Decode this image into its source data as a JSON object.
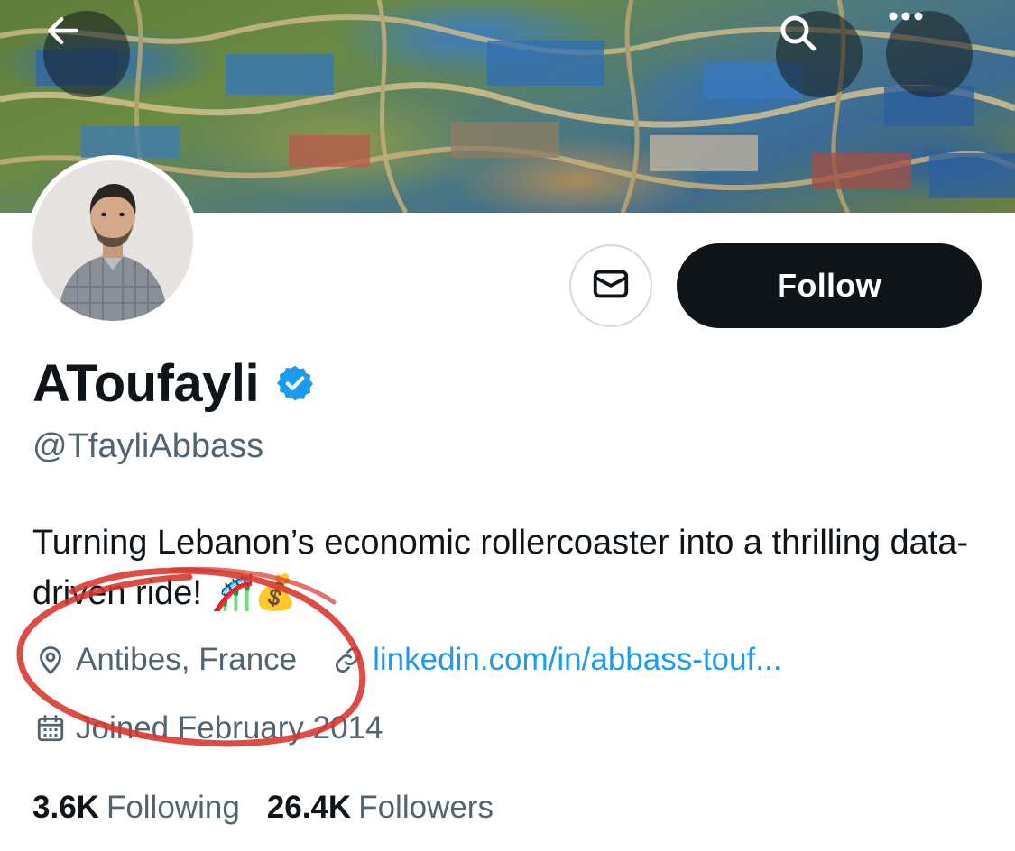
{
  "header": {
    "back_icon": "arrow-left-icon",
    "search_icon": "search-icon",
    "more_icon": "more-horizontal-icon"
  },
  "profile": {
    "display_name": "AToufayli",
    "verified_icon": "verified-badge-icon",
    "handle": "@TfayliAbbass",
    "bio": "Turning Lebanon’s economic rollercoaster into a thrilling data-driven ride! 🎢💰",
    "location": "Antibes, France",
    "location_icon": "location-pin-icon",
    "link": "linkedin.com/in/abbass-touf...",
    "link_icon": "link-icon",
    "joined": "Joined February 2014",
    "joined_icon": "calendar-icon"
  },
  "actions": {
    "message_icon": "mail-icon",
    "follow_label": "Follow"
  },
  "stats": {
    "following_count": "3.6K",
    "following_label": "Following",
    "followers_count": "26.4K",
    "followers_label": "Followers"
  },
  "colors": {
    "accent": "#1d9bf0",
    "text_primary": "#0f1419",
    "text_secondary": "#536471",
    "annotation_circle": "#d9342b"
  }
}
